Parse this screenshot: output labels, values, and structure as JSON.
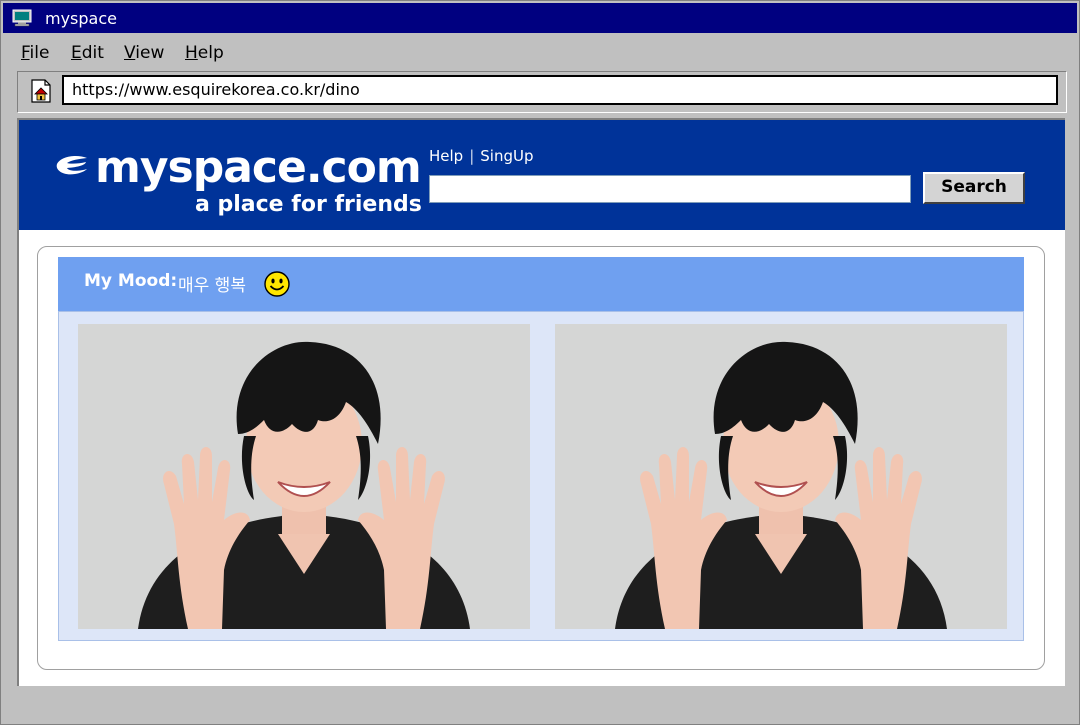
{
  "window": {
    "title": "myspace"
  },
  "menu": [
    {
      "label": "File",
      "accel": "F",
      "rest": "ile"
    },
    {
      "label": "Edit",
      "accel": "E",
      "rest": "dit"
    },
    {
      "label": "View",
      "accel": "V",
      "rest": "iew"
    },
    {
      "label": "Help",
      "accel": "H",
      "rest": "elp"
    }
  ],
  "address": {
    "url": "https://www.esquirekorea.co.kr/dino"
  },
  "header": {
    "logo_main": "myspace.com",
    "logo_tag": "a place for friends",
    "link_help": "Help",
    "link_signup": "SingUp",
    "search_button": "Search",
    "search_value": ""
  },
  "mood": {
    "label": "My Mood:",
    "value": "매우 행복"
  },
  "colors": {
    "title_bar": "#000080",
    "header_blue": "#003399",
    "mood_bar": "#6fa0f0",
    "photo_panel": "#dde6f8"
  },
  "icons": {
    "title": "computer-icon",
    "page": "page-home-icon",
    "mood": "smiley-icon",
    "logo": "myspace-logo-icon"
  },
  "photos": [
    {
      "alt_name": "photo-person-waving-1"
    },
    {
      "alt_name": "photo-person-waving-2"
    }
  ]
}
